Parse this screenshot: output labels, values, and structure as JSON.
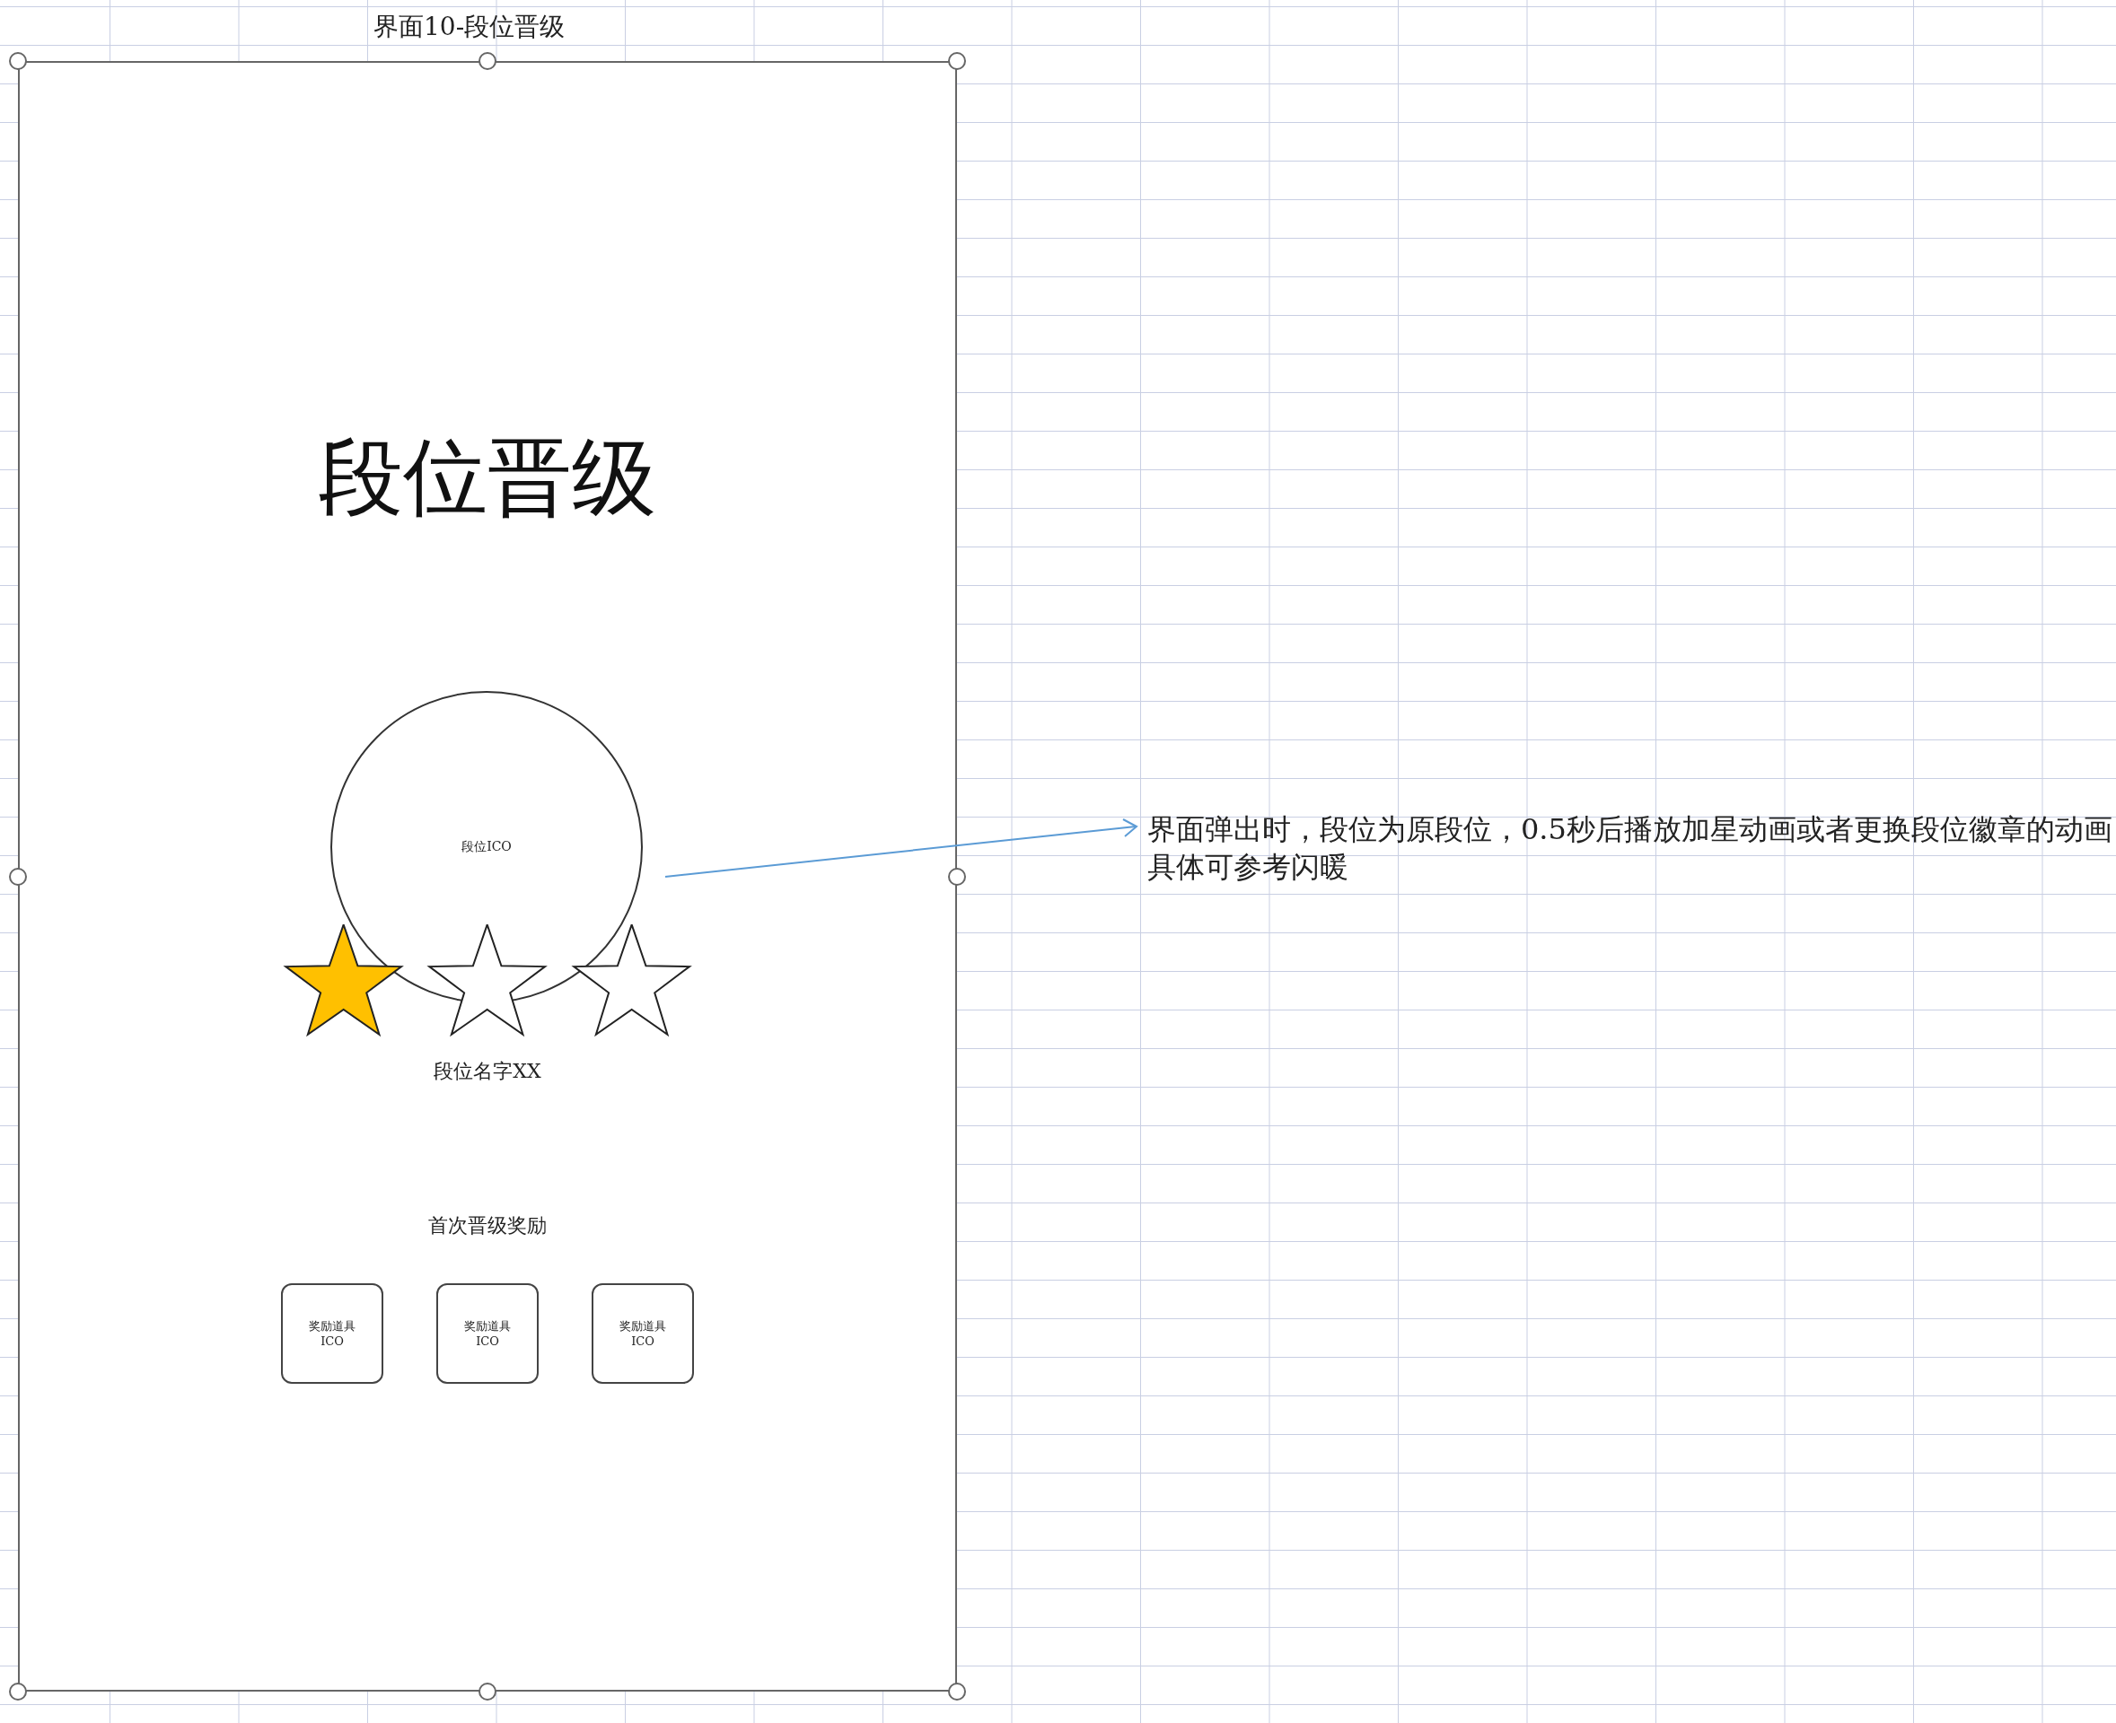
{
  "sheet_title": "界面10-段位晋级",
  "mockup": {
    "heading": "段位晋级",
    "rank_icon": {
      "label": "段位ICO"
    },
    "stars": 1,
    "rank_name": "段位名字XX",
    "reward_title": "首次晋级奖励",
    "rewards": [
      {
        "label": "奖励道具",
        "sub": "ICO"
      },
      {
        "label": "奖励道具",
        "sub": "ICO"
      },
      {
        "label": "奖励道具",
        "sub": "ICO"
      }
    ]
  },
  "annotation": {
    "lines": [
      "界面弹出时，段位为原段位，0.5秒后播放加星动画或者更换段位徽章的动画",
      "具体可参考闪暖"
    ]
  }
}
